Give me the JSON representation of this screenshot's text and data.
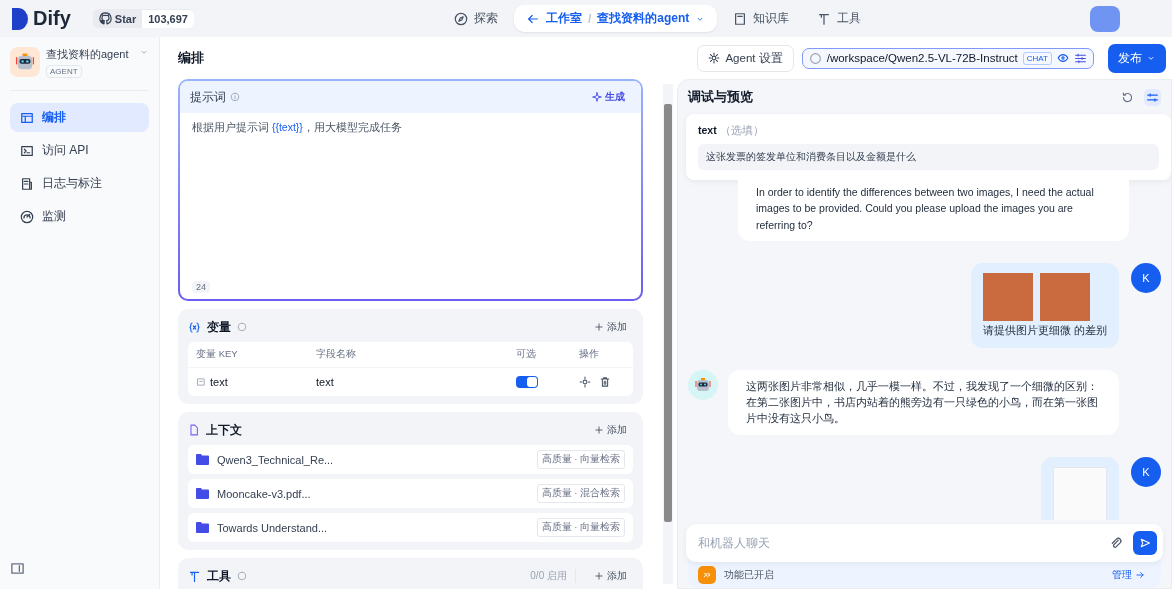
{
  "top_nav": {
    "logo": "Dify",
    "github": {
      "label": "Star",
      "count": "103,697"
    },
    "items": [
      {
        "kind": "explore",
        "label": "探索",
        "selected": false
      },
      {
        "kind": "studio",
        "label": "工作室",
        "separator": "/",
        "crumb": "查找资料的agent",
        "selected": true
      },
      {
        "kind": "knowledge",
        "label": "知识库",
        "selected": false
      },
      {
        "kind": "tools",
        "label": "工具",
        "selected": false
      }
    ]
  },
  "app": {
    "name": "查找资料的agent",
    "type": "AGENT"
  },
  "sidebar": {
    "items": [
      {
        "kind": "layout",
        "label": "编排",
        "selected": true
      },
      {
        "kind": "terminal",
        "label": "访问 API",
        "selected": false
      },
      {
        "kind": "log",
        "label": "日志与标注",
        "selected": false
      },
      {
        "kind": "monitor",
        "label": "监测",
        "selected": false
      }
    ]
  },
  "header": {
    "title": "编排",
    "agent_settings": "Agent 设置",
    "model": {
      "name": "/workspace/Qwen2.5-VL-72B-Instruct",
      "mode": "CHAT"
    },
    "publish": "发布"
  },
  "prompt": {
    "title": "提示词",
    "generate": "生成",
    "text_before": "根据用户提示词 ",
    "variable": "{{text}}",
    "text_after": "，用大模型完成任务",
    "count": "24"
  },
  "variables": {
    "title": "变量",
    "add": "添加",
    "columns": [
      "变量 KEY",
      "字段名称",
      "可选",
      "操作"
    ],
    "rows": [
      {
        "key": "text",
        "name": "text",
        "optional": true
      }
    ]
  },
  "context": {
    "title": "上下文",
    "add": "添加",
    "items": [
      {
        "name": "Qwen3_Technical_Re...",
        "tag": "高质量 · 向量检索"
      },
      {
        "name": "Mooncake-v3.pdf...",
        "tag": "高质量 · 混合检索"
      },
      {
        "name": "Towards Understand...",
        "tag": "高质量 · 向量检索"
      }
    ]
  },
  "tools": {
    "title": "工具",
    "count": "0/0 启用",
    "add": "添加"
  },
  "preview": {
    "title": "调试与预览",
    "input": {
      "label": "text",
      "hint": "（选填）",
      "value": "这张发票的签发单位和消费条目以及金额是什么"
    },
    "messages": [
      {
        "kind": "bot",
        "show_avatar": false,
        "text": "In order to identify the differences between two images, I need the actual images to be provided. Could you please upload the images you are referring to?"
      },
      {
        "kind": "user",
        "avatar": "K",
        "images": [
          {
            "kind": "photo"
          },
          {
            "kind": "photo"
          }
        ],
        "text": "请提供图片更细微 的差别"
      },
      {
        "kind": "bot",
        "show_avatar": true,
        "text": "这两张图片非常相似，几乎一模一样。不过，我发现了一个细微的区别：在第二张图片中，书店内站着的熊旁边有一只绿色的小鸟，而在第一张图片中没有这只小鸟。"
      },
      {
        "kind": "user",
        "avatar": "K",
        "images": [
          {
            "kind": "document"
          }
        ]
      }
    ],
    "chat_input": {
      "placeholder": "和机器人聊天"
    },
    "features": {
      "label": "功能已开启",
      "manage": "管理"
    }
  }
}
